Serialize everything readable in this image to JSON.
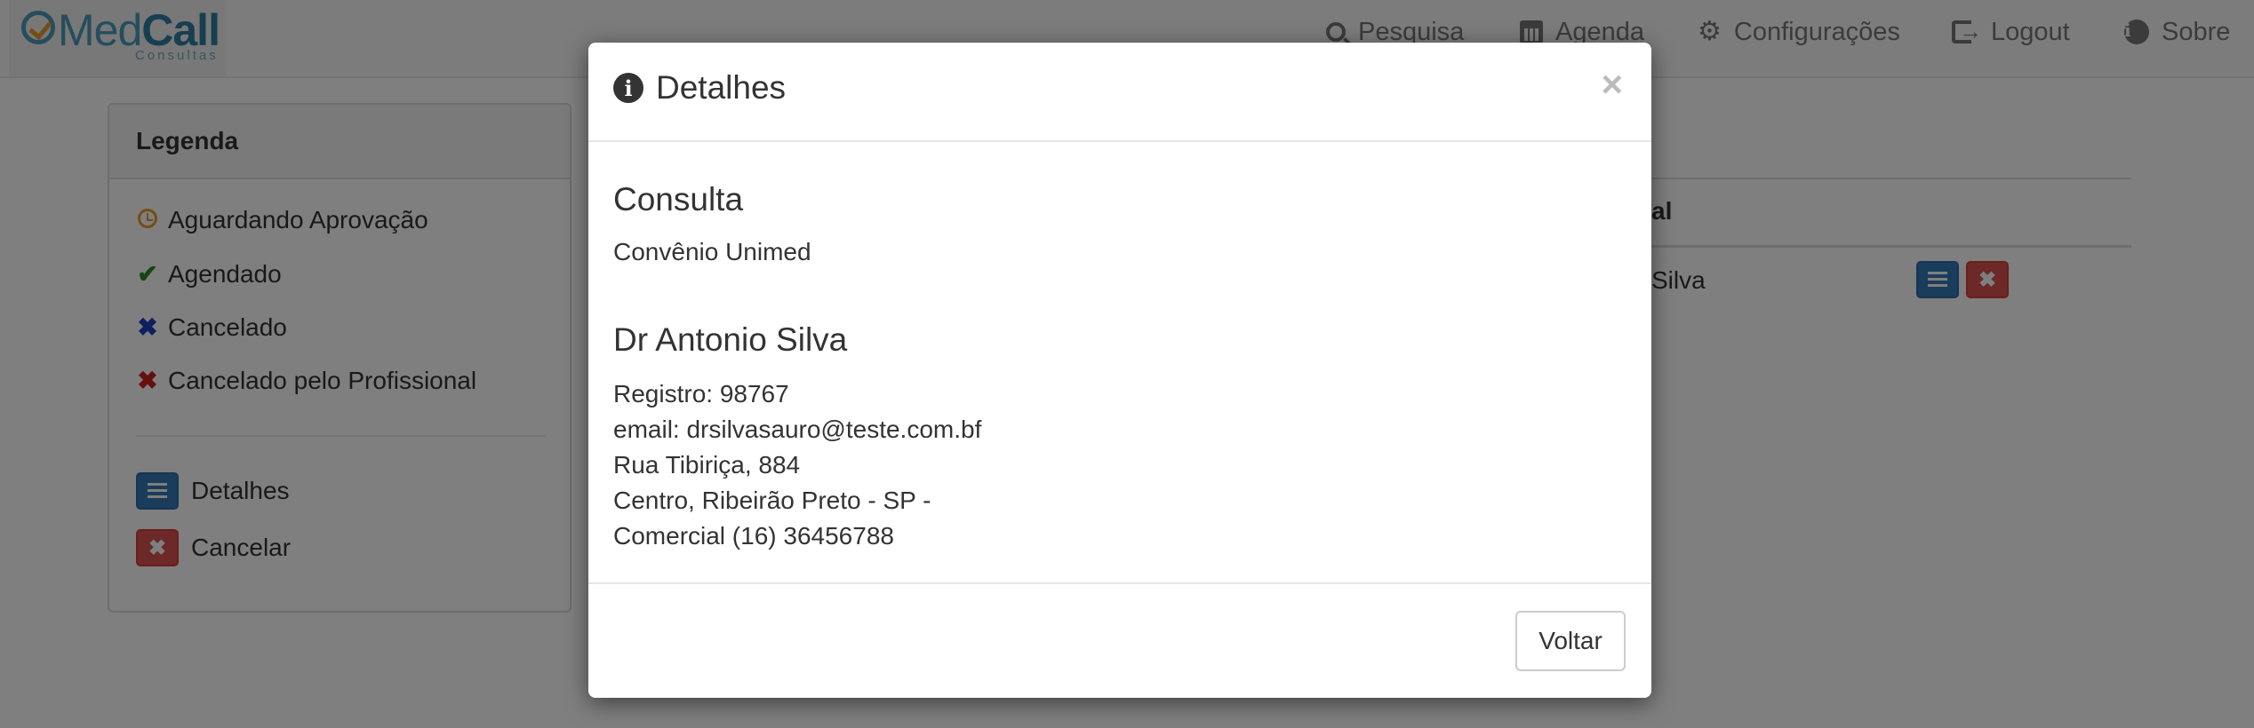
{
  "brand": {
    "name_light": "Med",
    "name_bold": "Call",
    "sub": "Consultas"
  },
  "nav": {
    "items": [
      {
        "label": "Pesquisa",
        "icon": "search-icon"
      },
      {
        "label": "Agenda",
        "icon": "calendar-icon"
      },
      {
        "label": "Configurações",
        "icon": "gear-icon"
      },
      {
        "label": "Logout",
        "icon": "logout-icon"
      },
      {
        "label": "Sobre",
        "icon": "info-icon"
      }
    ]
  },
  "legend": {
    "title": "Legenda",
    "statuses": [
      {
        "label": "Aguardando Aprovação",
        "icon": "clock-icon",
        "color": "#e89a2c"
      },
      {
        "label": "Agendado",
        "icon": "check-icon",
        "color": "#2d8a2d"
      },
      {
        "label": "Cancelado",
        "icon": "x-icon",
        "color": "#1a3fbf"
      },
      {
        "label": "Cancelado pelo Profissional",
        "icon": "x-icon",
        "color": "#cc1f1f"
      }
    ],
    "actions": [
      {
        "label": "Detalhes",
        "icon": "list-icon"
      },
      {
        "label": "Cancelar",
        "icon": "times-icon"
      }
    ]
  },
  "background_table": {
    "header_fragment": "al",
    "cell_fragment": "Silva"
  },
  "modal": {
    "title": "Detalhes",
    "close": "×",
    "consulta_heading": "Consulta",
    "convenio": "Convênio Unimed",
    "doctor_name": "Dr Antonio Silva",
    "registro": "Registro: 98767",
    "email": "email: drsilvasauro@teste.com.bf",
    "address_line1": "Rua Tibiriça, 884",
    "address_line2": "Centro, Ribeirão Preto - SP -",
    "phone": "Comercial (16) 36456788",
    "back_button": "Voltar"
  },
  "colors": {
    "primary": "#337ab7",
    "danger": "#d9534f",
    "brand": "#4a9bbb"
  }
}
